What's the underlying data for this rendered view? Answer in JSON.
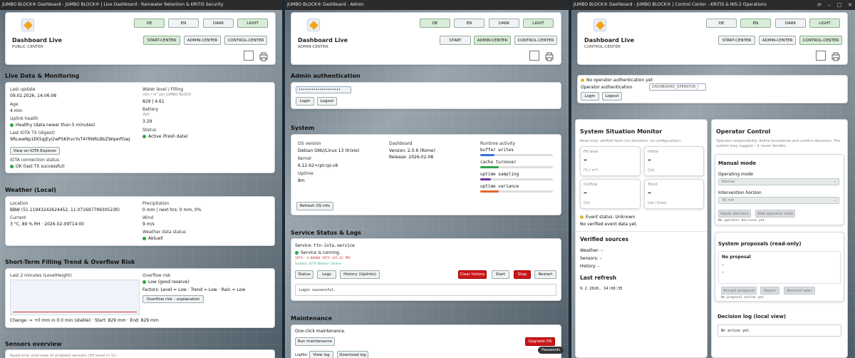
{
  "w1": {
    "title": "JUMBO BLOCK® Dashboard - JUMBO BLOCK® | Live Dashboard - Rainwater Retention & KRITIS Security",
    "header": {
      "title": "Dashboard Live",
      "subtitle": "PUBLIC-CENTER",
      "lang": [
        "DE",
        "EN",
        "DARK",
        "LIGHT"
      ],
      "nav": [
        "START-CENTER",
        "ADMIN-CENTER",
        "CONTROL-CENTER"
      ]
    },
    "live": {
      "heading": "Live Data & Monitoring",
      "last_update_label": "Last update",
      "last_update": "09.02.2026, 14:06:08",
      "age_label": "Age",
      "age": "4 min",
      "uplink_label": "Uplink health",
      "uplink": "Healthy (data newer than 5 minutes)",
      "iota_label": "Last IOTA TX (digest)",
      "iota": "9RLwwNp1EK5qjEyi2wPSKihvcYuT4YRNRLBbZWqwrfGwJ",
      "iota_btn": "View on IOTA Explorer",
      "iota_conn_label": "IOTA connection status",
      "iota_conn": "OK (last TX successful)",
      "water_label": "Water level / Filling",
      "water_unit": "mm / m³ per JUMBO BLOCK",
      "water": "829 | 4.61",
      "battery_label": "Battery",
      "battery_unit": "Volt",
      "battery": "3.29",
      "status_label": "Status",
      "status": "Active (fresh data)"
    },
    "weather": {
      "heading": "Weather (Local)",
      "location_label": "Location",
      "location": "BBW (51.11943242624452, 11.07169779930523б)",
      "current_label": "Current",
      "current": "3 °C, 89 % RH · 2026-02-09T14:00",
      "precip_label": "Precipitation",
      "precip": "0 mm | next hrs: 0 mm, 0%",
      "wind_label": "Wind",
      "wind": "9 m/s",
      "wstatus_label": "Weather data status",
      "wstatus": "Aktuell"
    },
    "trend": {
      "heading": "Short-Term Filling Trend & Overflow Risk",
      "chart_label": "Last 2 minutes (LevelHeight)",
      "risk_label": "Overflow risk",
      "risk": "Low (good reserve)",
      "factors": "Factors: Level = Low · Trend = Low · Rain = Low",
      "risk_btn": "Overflow risk – explanation",
      "change": "Change: ≈ +0 mm in 0.0 min (stable) · Start: 829 mm · End: 829 mm"
    },
    "sensors": {
      "heading": "Sensors overview",
      "desc": "Read-only overview of enabled sensors (fill level in %)"
    }
  },
  "w2": {
    "title": "JUMBO BLOCK® Dashboard - Admin",
    "header": {
      "title": "Dashboard Live",
      "subtitle": "ADMIN-CENTER",
      "lang": [
        "DE",
        "EN",
        "DARK",
        "LIGHT"
      ],
      "nav": [
        "START",
        "ADMIN-CENTER",
        "CONTROL-CENTER"
      ]
    },
    "auth": {
      "heading": "Admin authentication",
      "password": "••••••••••••••••••••",
      "login": "Login",
      "logout": "Logout"
    },
    "system": {
      "heading": "System",
      "os_label": "OS version",
      "os": "Debian GNU/Linux 13 (trixie)",
      "kernel_label": "Kernel",
      "kernel": "6.12.62+rpt-rpi-v8",
      "uptime_label": "Uptime",
      "uptime": "8m",
      "dash_label": "Dashboard",
      "dash_version": "Version: 2.0.6 (Rome)",
      "dash_release": "Release: 2026-02-08",
      "runtime_label": "Runtime activity",
      "runtime": [
        {
          "name": "buffer writes",
          "fill": 0.2,
          "color": "#3b6fd8"
        },
        {
          "name": "cache turnover",
          "fill": 0.25,
          "color": "#2fa14b"
        },
        {
          "name": "uptime sampling",
          "fill": 0.15,
          "color": "#6b2fa8"
        },
        {
          "name": "uptime variance",
          "fill": 0.25,
          "color": "#e06a2a"
        }
      ],
      "refresh": "Refresh OS info"
    },
    "service": {
      "heading": "Service Status & Logs",
      "service_label": "Service:",
      "service_name": "ttn-iota.service",
      "running": "Service is running.",
      "iota_line": "IOTA: 4.00000 IOTA (01.42 PM)",
      "system_line": "System: IOTA Worker: Online",
      "buttons": [
        "Status",
        "Logs",
        "History (Uplinks)"
      ],
      "clear": "Clear history",
      "start": "Start",
      "stop": "Stop",
      "restart": "Restart",
      "log": "Login successful."
    },
    "maint": {
      "heading": "Maintenance",
      "desc": "One-click maintenance.",
      "run": "Run maintenance",
      "upgrade": "Upgrade OS",
      "logfile": "Logfile:",
      "view": "View log",
      "download": "Download log",
      "passwords": "Passwords"
    }
  },
  "w3": {
    "title": "JUMBO BLOCK® Dashboard - JUMBO BLOCK® | Control Center - KRITIS & NIS-2 Operations",
    "header": {
      "title": "Dashboard Live",
      "subtitle": "CONTROL-CENTER",
      "lang": [
        "DE",
        "EN",
        "DARK",
        "LIGHT"
      ],
      "nav": [
        "START-CENTER",
        "ADMIN-CENTER",
        "CONTROL-CENTER"
      ]
    },
    "auth": {
      "status": "No operator authentication yet",
      "op_label": "Operator authentication",
      "op_value": "DASHBOARD_OPERATOR_I",
      "login": "Login",
      "logout": "Logout"
    },
    "monitor": {
      "heading": "System Situation Monitor",
      "desc": "Read-only: verified facts (no decisions, no configuration).",
      "tiles": [
        {
          "label": "Fill level",
          "value": "–",
          "unit": "(% / m³)"
        },
        {
          "label": "Inflow",
          "value": "–",
          "unit": "(l/s)"
        },
        {
          "label": "Outflow",
          "value": "–",
          "unit": "(l/s)"
        },
        {
          "label": "Trend",
          "value": "–",
          "unit": "(rel / time)"
        }
      ],
      "event": "Event status: Unknown",
      "event_desc": "No verified event data yet.",
      "sources_heading": "Verified sources",
      "weather": "Weather: –",
      "sensors": "Sensors: –",
      "history": "History: –",
      "refresh_heading": "Last refresh",
      "refresh": "9.2.2026, 14:08:35"
    },
    "control": {
      "heading": "Operator Control",
      "desc": "Operator responsibility: define boundaries and confirm decisions. The system may suggest – it never decides.",
      "manual_heading": "Manual mode",
      "op_mode_label": "Operating mode",
      "op_mode": "Normal",
      "horizon_label": "Intervention horizon",
      "horizon": "30 min",
      "apply": "Apply decision",
      "add_note": "Add operator note",
      "no_decision": "No operator decision yet.",
      "proposals_heading": "System proposals (read-only)",
      "no_proposal": "No proposal",
      "dash1": "–",
      "dash2": "–",
      "accept": "Accept proposal",
      "reject": "Reject",
      "remind": "Remind later",
      "no_action": "No proposal action yet.",
      "log_heading": "Decision log (local view)",
      "log": "No action yet."
    }
  }
}
